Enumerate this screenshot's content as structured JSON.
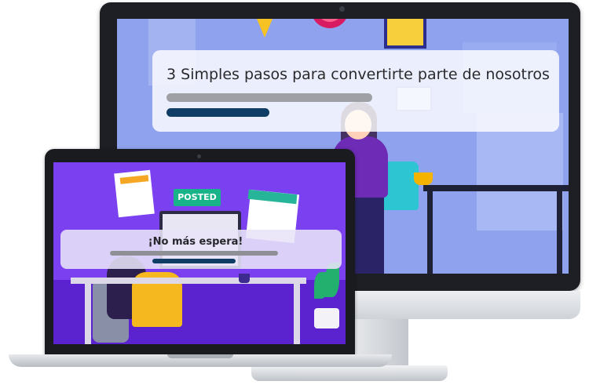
{
  "desktop": {
    "card": {
      "title": "3 Simples pasos para convertirte parte de nosotros"
    }
  },
  "laptop": {
    "card": {
      "title": "¡No más espera!"
    },
    "illustration": {
      "posted_label": "POSTED"
    }
  },
  "colors": {
    "monitor_screen_bg": "#8fa2ee",
    "laptop_screen_bg": "#6a2fe0",
    "progress_bar_track": "#9ea0a6",
    "progress_bar_fill": "#0f3d66"
  }
}
